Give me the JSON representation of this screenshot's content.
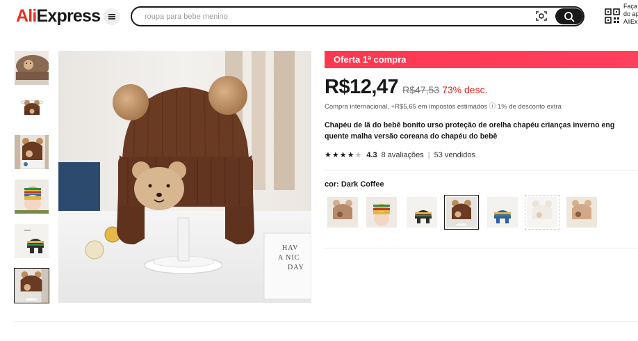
{
  "header": {
    "logo": "AliExpress",
    "search_placeholder": "roupa para bebe menino",
    "app_promo_lines": [
      "Faça",
      "do ap",
      "AliExp"
    ]
  },
  "product": {
    "promo_banner": "Oferta 1ª compra",
    "price": "R$12,47",
    "old_price": "R$47,53",
    "discount": "73% desc.",
    "tax_info": "Compra internacional, +R$5,65 em impostos estimados ⓘ 1% de desconto extra",
    "title_line1": "Chapéu de lã do bebê bonito urso proteção de orelha chapéu crianças inverno eng",
    "title_line2": "quente malha versão coreana do chapéu do bebê",
    "rating": "4.3",
    "reviews": "8 avaliações",
    "sold": "53 vendidos",
    "rating_fraction": 0.86,
    "color_label": "cor: Dark Coffee"
  },
  "main_image": {
    "card_text": [
      "HAV",
      "A NIC",
      "DAY"
    ]
  },
  "colors": {
    "brand_red": "#e43225",
    "promo_red": "#fd384f",
    "discount_red": "#e2231a",
    "hat_brown": "#6b3a22"
  }
}
